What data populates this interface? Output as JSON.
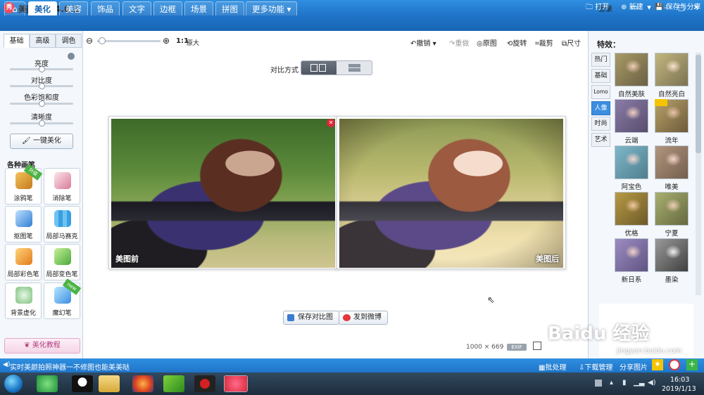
{
  "app": {
    "title": "美图秀秀 4.0.1",
    "logo_text": "秀",
    "login": "登录"
  },
  "menu": {
    "tabs": [
      "美化",
      "美容",
      "饰品",
      "文字",
      "边框",
      "场景",
      "拼图",
      "更多功能"
    ],
    "actions": {
      "open": "打开",
      "new": "新建",
      "save_share": "保存与分享"
    }
  },
  "left": {
    "subtabs": [
      "基础",
      "高级",
      "调色"
    ],
    "sliders": [
      "亮度",
      "对比度",
      "色彩饱和度",
      "清晰度"
    ],
    "slider_values": [
      0.5,
      0.5,
      0.5,
      0.5
    ],
    "one_key": "一键美化",
    "brushes_title": "各种画笔",
    "tools": [
      "涂鸦笔",
      "消除笔",
      "抠图笔",
      "局部马赛克",
      "局部彩色笔",
      "局部变色笔",
      "背景虚化",
      "魔幻笔"
    ],
    "badge_upgrade": "升级",
    "badge_new": "new",
    "tutorial": "美化教程"
  },
  "toolbar": {
    "zoom_ratio": "1:1",
    "zoom_original": "原大",
    "undo": "撤销",
    "redo": "重做",
    "original": "原图",
    "rotate": "旋转",
    "crop": "裁剪",
    "size": "尺寸"
  },
  "compare": {
    "label": "对比方式"
  },
  "photos": {
    "before": "美图前",
    "after": "美图后"
  },
  "bottom": {
    "save_compare": "保存对比图",
    "post_weibo": "发到微博",
    "image_size": "1000 × 669",
    "exif": "EXIF"
  },
  "right": {
    "title": "特效：",
    "categories": [
      "热门",
      "基础",
      "Lomo",
      "人像",
      "时尚",
      "艺术"
    ],
    "active_category": "人像",
    "effects": [
      "自然美肤",
      "自然亮白",
      "云端",
      "流年",
      "阿宝色",
      "唯美",
      "优格",
      "宁夏",
      "新日系",
      "墨染"
    ]
  },
  "status": {
    "text": "实时美颜拍照神器一不修图也能美美哒",
    "batch": "批处理",
    "download": "下载管理",
    "share": "分享图片"
  },
  "taskbar": {
    "time": "16:03",
    "date": "2019/1/13"
  },
  "watermark": {
    "text": "Baidu 经验",
    "url": "jingyan.baidu.com"
  }
}
